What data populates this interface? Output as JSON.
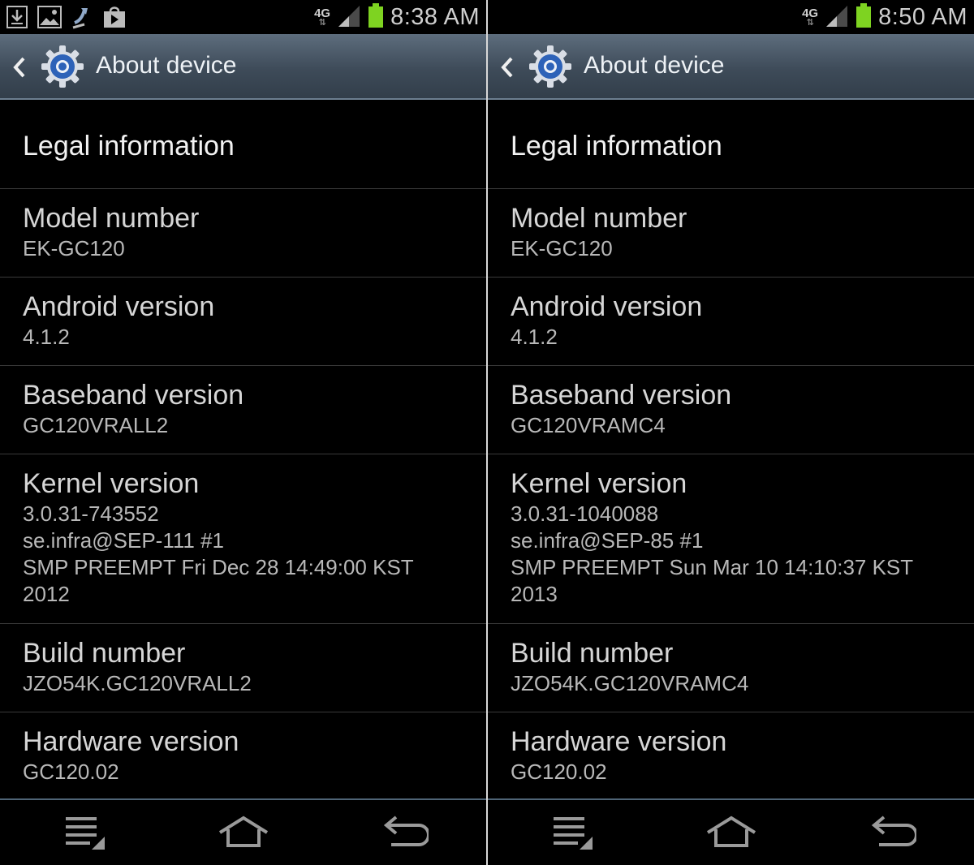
{
  "screens": [
    {
      "status_bar": {
        "network": "4G",
        "network_sub": "LTE",
        "time": "8:38 AM",
        "notification_icons": [
          "download-icon",
          "image-icon",
          "sync-icon",
          "store-icon"
        ]
      },
      "header": {
        "title": "About device"
      },
      "legal": "Legal information",
      "items": [
        {
          "title": "Model number",
          "value": "EK-GC120"
        },
        {
          "title": "Android version",
          "value": "4.1.2"
        },
        {
          "title": "Baseband version",
          "value": "GC120VRALL2"
        },
        {
          "title": "Build number",
          "value": "JZO54K.GC120VRALL2"
        },
        {
          "title": "Hardware version",
          "value": "GC120.02"
        }
      ],
      "kernel": {
        "title": "Kernel version",
        "lines": [
          "3.0.31-743552",
          "se.infra@SEP-111 #1",
          "SMP PREEMPT Fri Dec 28 14:49:00 KST",
          "2012"
        ]
      }
    },
    {
      "status_bar": {
        "network": "4G",
        "network_sub": "LTE",
        "time": "8:50 AM",
        "notification_icons": []
      },
      "header": {
        "title": "About device"
      },
      "legal": "Legal information",
      "items": [
        {
          "title": "Model number",
          "value": "EK-GC120"
        },
        {
          "title": "Android version",
          "value": "4.1.2"
        },
        {
          "title": "Baseband version",
          "value": "GC120VRAMC4"
        },
        {
          "title": "Build number",
          "value": "JZO54K.GC120VRAMC4"
        },
        {
          "title": "Hardware version",
          "value": "GC120.02"
        }
      ],
      "kernel": {
        "title": "Kernel version",
        "lines": [
          "3.0.31-1040088",
          "se.infra@SEP-85 #1",
          "SMP PREEMPT Sun Mar 10 14:10:37 KST",
          "2013"
        ]
      }
    }
  ],
  "colors": {
    "action_bar": "#3e4b59",
    "battery": "#7ed321",
    "background": "#000000",
    "gear": "#3b6fc4"
  }
}
